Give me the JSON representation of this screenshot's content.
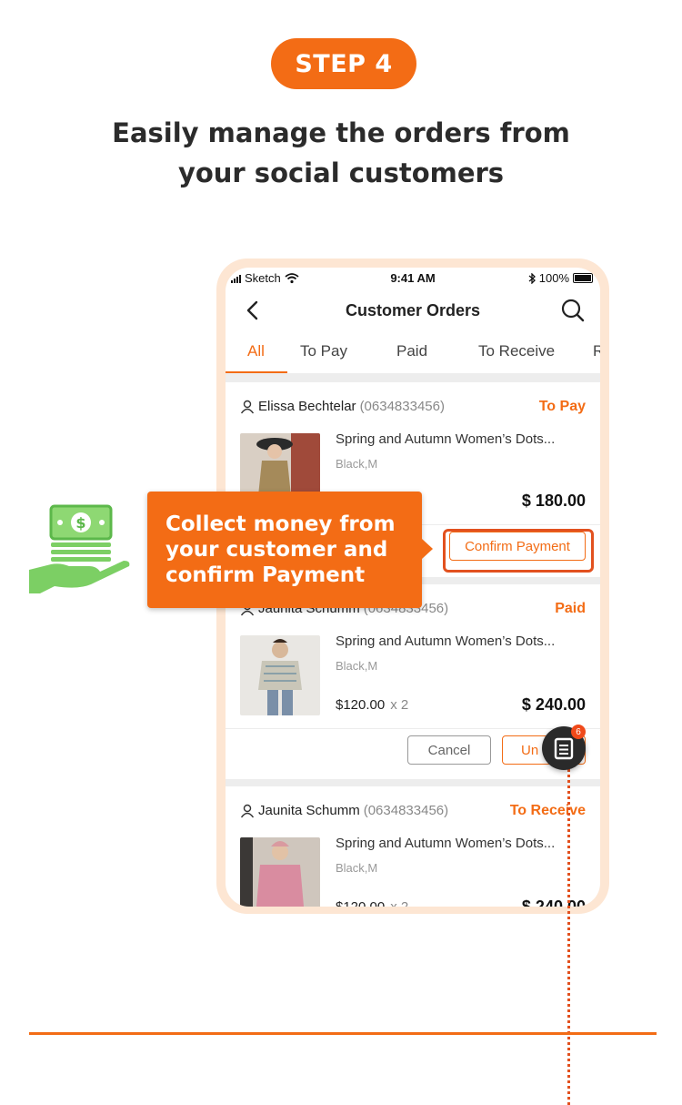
{
  "step": {
    "label": "STEP 4"
  },
  "headline": {
    "line1": "Easily manage the orders from",
    "line2": "your social customers"
  },
  "statusbar": {
    "carrier": "Sketch",
    "time": "9:41 AM",
    "battery": "100%"
  },
  "navbar": {
    "title": "Customer Orders"
  },
  "tabs": [
    {
      "label": "All",
      "active": true
    },
    {
      "label": "To Pay"
    },
    {
      "label": "Paid"
    },
    {
      "label": "To Receive"
    },
    {
      "label": "R"
    }
  ],
  "orders": [
    {
      "customer": "Elissa Bechtelar",
      "phone": "(0634833456)",
      "status": "To Pay",
      "product": "Spring and Autumn Women’s Dots...",
      "variant": "Black,M",
      "total": "$ 180.00",
      "action": "Confirm Payment"
    },
    {
      "customer": "Jaunita Schumm",
      "phone": "(0634833456)",
      "status": "Paid",
      "product": "Spring and Autumn Women’s Dots...",
      "variant": "Black,M",
      "unit_price": "$120.00",
      "qty": "x 2",
      "total": "$ 240.00",
      "cancel": "Cancel",
      "action": "Un"
    },
    {
      "customer": "Jaunita Schumm",
      "phone": "(0634833456)",
      "status": "To Receive",
      "product": "Spring and Autumn Women’s Dots...",
      "variant": "Black,M",
      "unit_price": "$120.00",
      "qty": "x 2",
      "total": "$ 240.00"
    }
  ],
  "callout": {
    "line1": "Collect money from",
    "line2": "your customer and",
    "line3": "confirm Payment"
  },
  "fab": {
    "badge": "6"
  },
  "colors": {
    "accent": "#f36c15",
    "highlight": "#e2511f",
    "money_green": "#7ccf64"
  }
}
